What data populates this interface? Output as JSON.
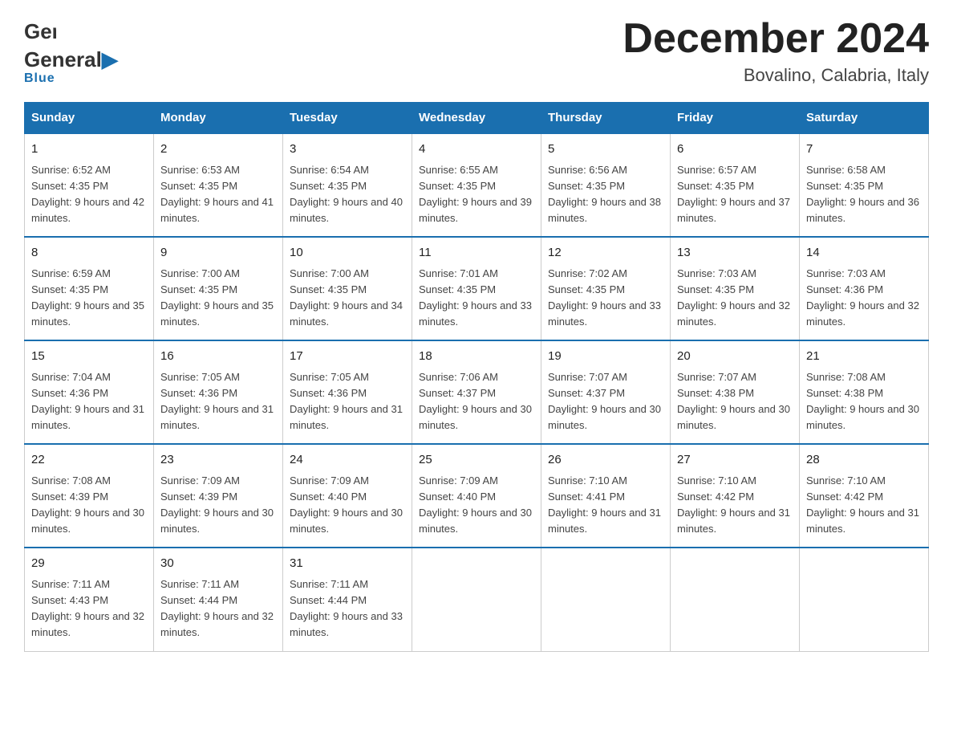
{
  "header": {
    "logo_general": "General",
    "logo_blue": "Blue",
    "title": "December 2024",
    "subtitle": "Bovalino, Calabria, Italy"
  },
  "days_of_week": [
    "Sunday",
    "Monday",
    "Tuesday",
    "Wednesday",
    "Thursday",
    "Friday",
    "Saturday"
  ],
  "weeks": [
    [
      {
        "num": "1",
        "sunrise": "6:52 AM",
        "sunset": "4:35 PM",
        "daylight": "9 hours and 42 minutes."
      },
      {
        "num": "2",
        "sunrise": "6:53 AM",
        "sunset": "4:35 PM",
        "daylight": "9 hours and 41 minutes."
      },
      {
        "num": "3",
        "sunrise": "6:54 AM",
        "sunset": "4:35 PM",
        "daylight": "9 hours and 40 minutes."
      },
      {
        "num": "4",
        "sunrise": "6:55 AM",
        "sunset": "4:35 PM",
        "daylight": "9 hours and 39 minutes."
      },
      {
        "num": "5",
        "sunrise": "6:56 AM",
        "sunset": "4:35 PM",
        "daylight": "9 hours and 38 minutes."
      },
      {
        "num": "6",
        "sunrise": "6:57 AM",
        "sunset": "4:35 PM",
        "daylight": "9 hours and 37 minutes."
      },
      {
        "num": "7",
        "sunrise": "6:58 AM",
        "sunset": "4:35 PM",
        "daylight": "9 hours and 36 minutes."
      }
    ],
    [
      {
        "num": "8",
        "sunrise": "6:59 AM",
        "sunset": "4:35 PM",
        "daylight": "9 hours and 35 minutes."
      },
      {
        "num": "9",
        "sunrise": "7:00 AM",
        "sunset": "4:35 PM",
        "daylight": "9 hours and 35 minutes."
      },
      {
        "num": "10",
        "sunrise": "7:00 AM",
        "sunset": "4:35 PM",
        "daylight": "9 hours and 34 minutes."
      },
      {
        "num": "11",
        "sunrise": "7:01 AM",
        "sunset": "4:35 PM",
        "daylight": "9 hours and 33 minutes."
      },
      {
        "num": "12",
        "sunrise": "7:02 AM",
        "sunset": "4:35 PM",
        "daylight": "9 hours and 33 minutes."
      },
      {
        "num": "13",
        "sunrise": "7:03 AM",
        "sunset": "4:35 PM",
        "daylight": "9 hours and 32 minutes."
      },
      {
        "num": "14",
        "sunrise": "7:03 AM",
        "sunset": "4:36 PM",
        "daylight": "9 hours and 32 minutes."
      }
    ],
    [
      {
        "num": "15",
        "sunrise": "7:04 AM",
        "sunset": "4:36 PM",
        "daylight": "9 hours and 31 minutes."
      },
      {
        "num": "16",
        "sunrise": "7:05 AM",
        "sunset": "4:36 PM",
        "daylight": "9 hours and 31 minutes."
      },
      {
        "num": "17",
        "sunrise": "7:05 AM",
        "sunset": "4:36 PM",
        "daylight": "9 hours and 31 minutes."
      },
      {
        "num": "18",
        "sunrise": "7:06 AM",
        "sunset": "4:37 PM",
        "daylight": "9 hours and 30 minutes."
      },
      {
        "num": "19",
        "sunrise": "7:07 AM",
        "sunset": "4:37 PM",
        "daylight": "9 hours and 30 minutes."
      },
      {
        "num": "20",
        "sunrise": "7:07 AM",
        "sunset": "4:38 PM",
        "daylight": "9 hours and 30 minutes."
      },
      {
        "num": "21",
        "sunrise": "7:08 AM",
        "sunset": "4:38 PM",
        "daylight": "9 hours and 30 minutes."
      }
    ],
    [
      {
        "num": "22",
        "sunrise": "7:08 AM",
        "sunset": "4:39 PM",
        "daylight": "9 hours and 30 minutes."
      },
      {
        "num": "23",
        "sunrise": "7:09 AM",
        "sunset": "4:39 PM",
        "daylight": "9 hours and 30 minutes."
      },
      {
        "num": "24",
        "sunrise": "7:09 AM",
        "sunset": "4:40 PM",
        "daylight": "9 hours and 30 minutes."
      },
      {
        "num": "25",
        "sunrise": "7:09 AM",
        "sunset": "4:40 PM",
        "daylight": "9 hours and 30 minutes."
      },
      {
        "num": "26",
        "sunrise": "7:10 AM",
        "sunset": "4:41 PM",
        "daylight": "9 hours and 31 minutes."
      },
      {
        "num": "27",
        "sunrise": "7:10 AM",
        "sunset": "4:42 PM",
        "daylight": "9 hours and 31 minutes."
      },
      {
        "num": "28",
        "sunrise": "7:10 AM",
        "sunset": "4:42 PM",
        "daylight": "9 hours and 31 minutes."
      }
    ],
    [
      {
        "num": "29",
        "sunrise": "7:11 AM",
        "sunset": "4:43 PM",
        "daylight": "9 hours and 32 minutes."
      },
      {
        "num": "30",
        "sunrise": "7:11 AM",
        "sunset": "4:44 PM",
        "daylight": "9 hours and 32 minutes."
      },
      {
        "num": "31",
        "sunrise": "7:11 AM",
        "sunset": "4:44 PM",
        "daylight": "9 hours and 33 minutes."
      },
      null,
      null,
      null,
      null
    ]
  ]
}
